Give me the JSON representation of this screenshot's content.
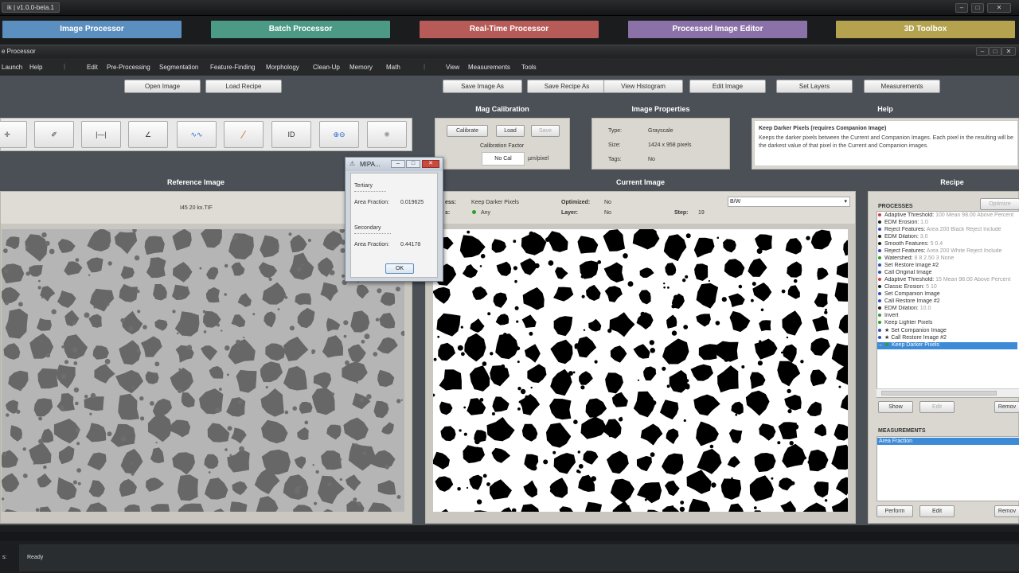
{
  "outer_window": {
    "title": "ik | v1.0.0-beta.1"
  },
  "launch_bar": [
    {
      "label": "Image Processor",
      "color": "#5b8fc0"
    },
    {
      "label": "Batch Processor",
      "color": "#4c9a86"
    },
    {
      "label": "Real-Time Processor",
      "color": "#b65b58"
    },
    {
      "label": "Processed Image Editor",
      "color": "#8a72a8"
    },
    {
      "label": "3D Toolbox",
      "color": "#b4a24e"
    }
  ],
  "inner_window": {
    "title": "e Processor"
  },
  "menu": [
    "Launch",
    "Help",
    "Edit",
    "Pre-Processing",
    "Segmentation",
    "Feature-Finding",
    "Morphology",
    "Clean-Up",
    "Memory",
    "Math",
    "View",
    "Measurements",
    "Tools"
  ],
  "toolbar": [
    "Open Image",
    "Load Recipe",
    "Save Image As",
    "Save Recipe As",
    "View Histogram",
    "Edit Image",
    "Set Layers",
    "Measurements"
  ],
  "tools": [
    {
      "icon": "move-icon",
      "glyph": "✛"
    },
    {
      "icon": "dropper-icon",
      "glyph": "✐"
    },
    {
      "icon": "measure-line-icon",
      "glyph": "|—|"
    },
    {
      "icon": "angle-icon",
      "glyph": "∠"
    },
    {
      "icon": "profile-icon",
      "glyph": "∿∿"
    },
    {
      "icon": "ruler-icon",
      "glyph": "∕"
    },
    {
      "icon": "id-icon",
      "glyph": "ID"
    },
    {
      "icon": "zoom-icon",
      "glyph": "⊕⊖"
    },
    {
      "icon": "spinner-icon",
      "glyph": "✺"
    }
  ],
  "mag_calibration": {
    "title": "Mag Calibration",
    "calibrate": "Calibrate",
    "load": "Load",
    "save": "Save",
    "factor_label": "Calibration Factor",
    "factor_value": "No Cal",
    "unit": "µm/pixel"
  },
  "image_properties": {
    "title": "Image Properties",
    "type_label": "Type:",
    "type_value": "Grayscale",
    "size_label": "Size:",
    "size_value": "1424 x 958 pixels",
    "tags_label": "Tags:",
    "tags_value": "No"
  },
  "help": {
    "title": "Help",
    "heading": "Keep Darker Pixels (requires Companion Image)",
    "text": "Keeps the darker pixels between the Current and Companion Images. Each pixel in the resulting will be the darkest value of that pixel in the Current and Companion images."
  },
  "reference": {
    "title": "Reference Image",
    "filename": "I45 20 kx.TIF"
  },
  "current": {
    "title": "Current Image",
    "process_label": "ess:",
    "process_value": "Keep Darker Pixels",
    "s_label": "s:",
    "s_value": "Any",
    "optimized_label": "Optimized:",
    "optimized_value": "No",
    "layer_label": "Layer:",
    "layer_value": "No",
    "step_label": "Step:",
    "step_value": "19",
    "mode": "B/W"
  },
  "recipe": {
    "title": "Recipe",
    "processes_label": "PROCESSES",
    "optimize": "Optimize",
    "processes": [
      {
        "name": "Adaptive Threshold:",
        "param": "100 Mean 98.00 Above Percent",
        "color": "#d04040"
      },
      {
        "name": "EDM Erosion:",
        "param": "1.0",
        "color": "#222222"
      },
      {
        "name": "Reject Features:",
        "param": "Area 200 Black Reject Include",
        "color": "#3050c0"
      },
      {
        "name": "EDM Dilation:",
        "param": "3.0",
        "color": "#222222"
      },
      {
        "name": "Smooth Features:",
        "param": "5 0.4",
        "color": "#222222"
      },
      {
        "name": "Reject Features:",
        "param": "Area 200 White Reject Include",
        "color": "#3050c0"
      },
      {
        "name": "Watershed:",
        "param": "8 8 2.50 3 None",
        "color": "#30a030"
      },
      {
        "name": "Set Restore Image #2",
        "param": "",
        "color": "#3050c0"
      },
      {
        "name": "Call Original Image",
        "param": "",
        "color": "#3050c0"
      },
      {
        "name": "Adaptive Threshold:",
        "param": "15 Mean 98.00 Above Percent",
        "color": "#d04040"
      },
      {
        "name": "Classic Erosion:",
        "param": "5 10",
        "color": "#222222"
      },
      {
        "name": "Set Companion Image",
        "param": "",
        "color": "#3050c0"
      },
      {
        "name": "Call Restore Image #2",
        "param": "",
        "color": "#3050c0"
      },
      {
        "name": "EDM Dilation:",
        "param": "10.0",
        "color": "#222222"
      },
      {
        "name": "Invert",
        "param": "",
        "color": "#30a030"
      },
      {
        "name": "Keep Lighter Pixels",
        "param": "",
        "color": "#30a030"
      },
      {
        "name": "★ Set Companion Image",
        "param": "",
        "color": "#3050c0"
      },
      {
        "name": "★ Call Restore Image #2",
        "param": "",
        "color": "#3050c0"
      },
      {
        "name": "Keep Darker Pixels",
        "param": "",
        "color": "#30a030"
      }
    ],
    "show": "Show",
    "edit": "Edit",
    "remove": "Remov",
    "measurements_label": "MEASUREMENTS",
    "measurements": [
      "Area Fraction"
    ],
    "perform": "Perform",
    "m_edit": "Edit",
    "m_remove": "Remov"
  },
  "dialog": {
    "title": "MIPA...",
    "s1_title": "Tertiary",
    "s1_label": "Area Fraction:",
    "s1_value": "0.019625",
    "s2_title": "Secondary",
    "s2_label": "Area Fraction:",
    "s2_value": "0.44178",
    "ok": "OK"
  },
  "status": {
    "label": "s:",
    "text": "Ready"
  }
}
